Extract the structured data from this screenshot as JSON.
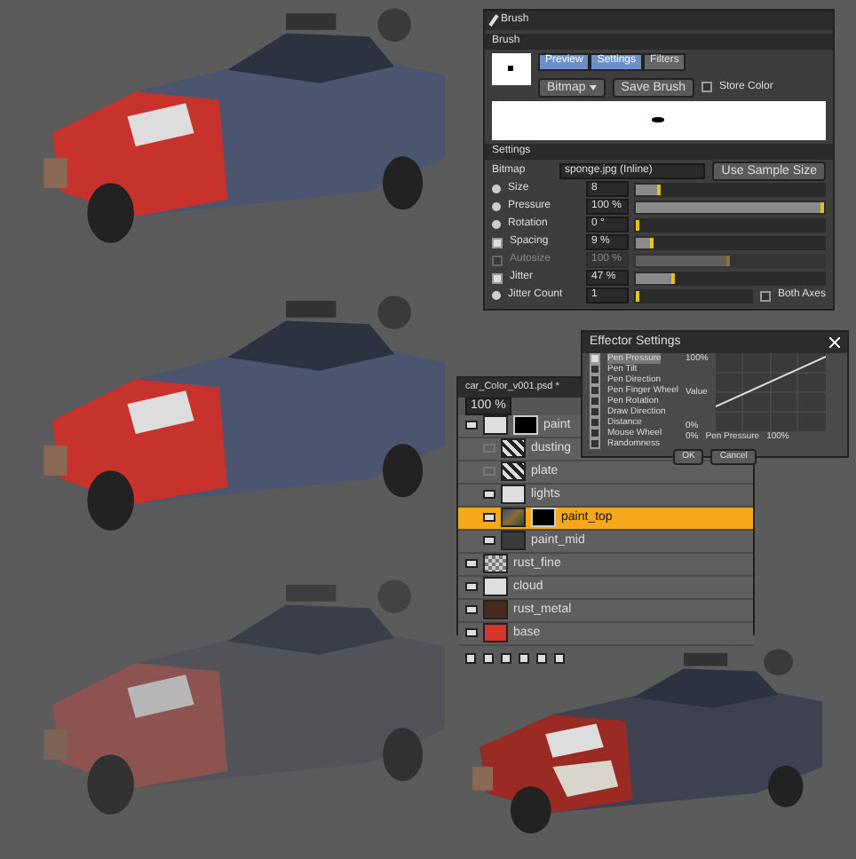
{
  "renders": [
    {
      "kind": "painted"
    },
    {
      "kind": "painted"
    },
    {
      "kind": "faded"
    },
    {
      "kind": "textured"
    }
  ],
  "brush_panel": {
    "title": "Brush",
    "section": "Brush",
    "tabs": [
      {
        "label": "Preview",
        "selected": true
      },
      {
        "label": "Settings",
        "selected": true
      },
      {
        "label": "Filters",
        "selected": false
      }
    ],
    "mode": "Bitmap",
    "save_button": "Save Brush",
    "store_color": {
      "label": "Store Color",
      "checked": false
    },
    "settings_section": "Settings",
    "bitmap_label": "Bitmap",
    "bitmap_value": "sponge.jpg (Inline)",
    "sample_button": "Use Sample Size",
    "params": [
      {
        "kind": "dot",
        "label": "Size",
        "value": "8",
        "level": 0.13,
        "disabled": false
      },
      {
        "kind": "dot",
        "label": "Pressure",
        "value": "100 %",
        "level": 1,
        "disabled": false
      },
      {
        "kind": "dot",
        "label": "Rotation",
        "value": "0 °",
        "level": 0,
        "disabled": false
      },
      {
        "kind": "check",
        "label": "Spacing",
        "value": "9 %",
        "level": 0.09,
        "checked": true,
        "disabled": false
      },
      {
        "kind": "check",
        "label": "Autosize",
        "value": "100 %",
        "level": 0.5,
        "checked": false,
        "disabled": true
      },
      {
        "kind": "check",
        "label": "Jitter",
        "value": "47 %",
        "level": 0.21,
        "checked": true,
        "disabled": false
      },
      {
        "kind": "dot",
        "label": "Jitter Count",
        "value": "1",
        "level": 0,
        "disabled": false,
        "extra": {
          "label": "Both Axes",
          "checked": false
        }
      }
    ]
  },
  "effector_dialog": {
    "title": "Effector Settings",
    "inputs": [
      {
        "label": "Pen Pressure",
        "checked": true,
        "selected": true
      },
      {
        "label": "Pen Tilt",
        "checked": false,
        "selected": false
      },
      {
        "label": "Pen Direction",
        "checked": false,
        "selected": false
      },
      {
        "label": "Pen Finger Wheel",
        "checked": false,
        "selected": false
      },
      {
        "label": "Pen Rotation",
        "checked": false,
        "selected": false
      },
      {
        "label": "Draw Direction",
        "checked": false,
        "selected": false
      },
      {
        "label": "Distance",
        "checked": false,
        "selected": false
      },
      {
        "label": "Mouse Wheel",
        "checked": false,
        "selected": false
      },
      {
        "label": "Randomness",
        "checked": false,
        "selected": false
      }
    ],
    "top_value": "100%",
    "value_label": "Value",
    "bottom_value": "0%",
    "x_min": "0%",
    "x_label": "Pen Pressure",
    "x_max": "100%",
    "buttons": [
      "OK",
      "Cancel"
    ]
  },
  "layers_panel": {
    "title": "car_Color_v001.psd *",
    "opacity": "100 %",
    "layers": [
      {
        "name": "paint",
        "kind": "white",
        "visible": true,
        "selected": false,
        "mask": true,
        "children": [
          {
            "name": "dusting",
            "kind": "noise",
            "visible": false,
            "selected": false,
            "mask": false
          },
          {
            "name": "plate",
            "kind": "noise",
            "visible": false,
            "selected": false,
            "mask": false
          },
          {
            "name": "lights",
            "kind": "white",
            "visible": true,
            "selected": false,
            "mask": false
          },
          {
            "name": "paint_top",
            "kind": "color",
            "visible": true,
            "selected": true,
            "mask": true
          },
          {
            "name": "paint_mid",
            "kind": "dark",
            "visible": true,
            "selected": false,
            "mask": false
          }
        ]
      },
      {
        "name": "rust_fine",
        "kind": "checker",
        "visible": true,
        "selected": false,
        "mask": false
      },
      {
        "name": "cloud",
        "kind": "white",
        "visible": true,
        "selected": false,
        "mask": false
      },
      {
        "name": "rust_metal",
        "kind": "brown",
        "visible": true,
        "selected": false,
        "mask": false
      },
      {
        "name": "base",
        "kind": "red",
        "visible": true,
        "selected": false,
        "mask": false
      }
    ]
  }
}
